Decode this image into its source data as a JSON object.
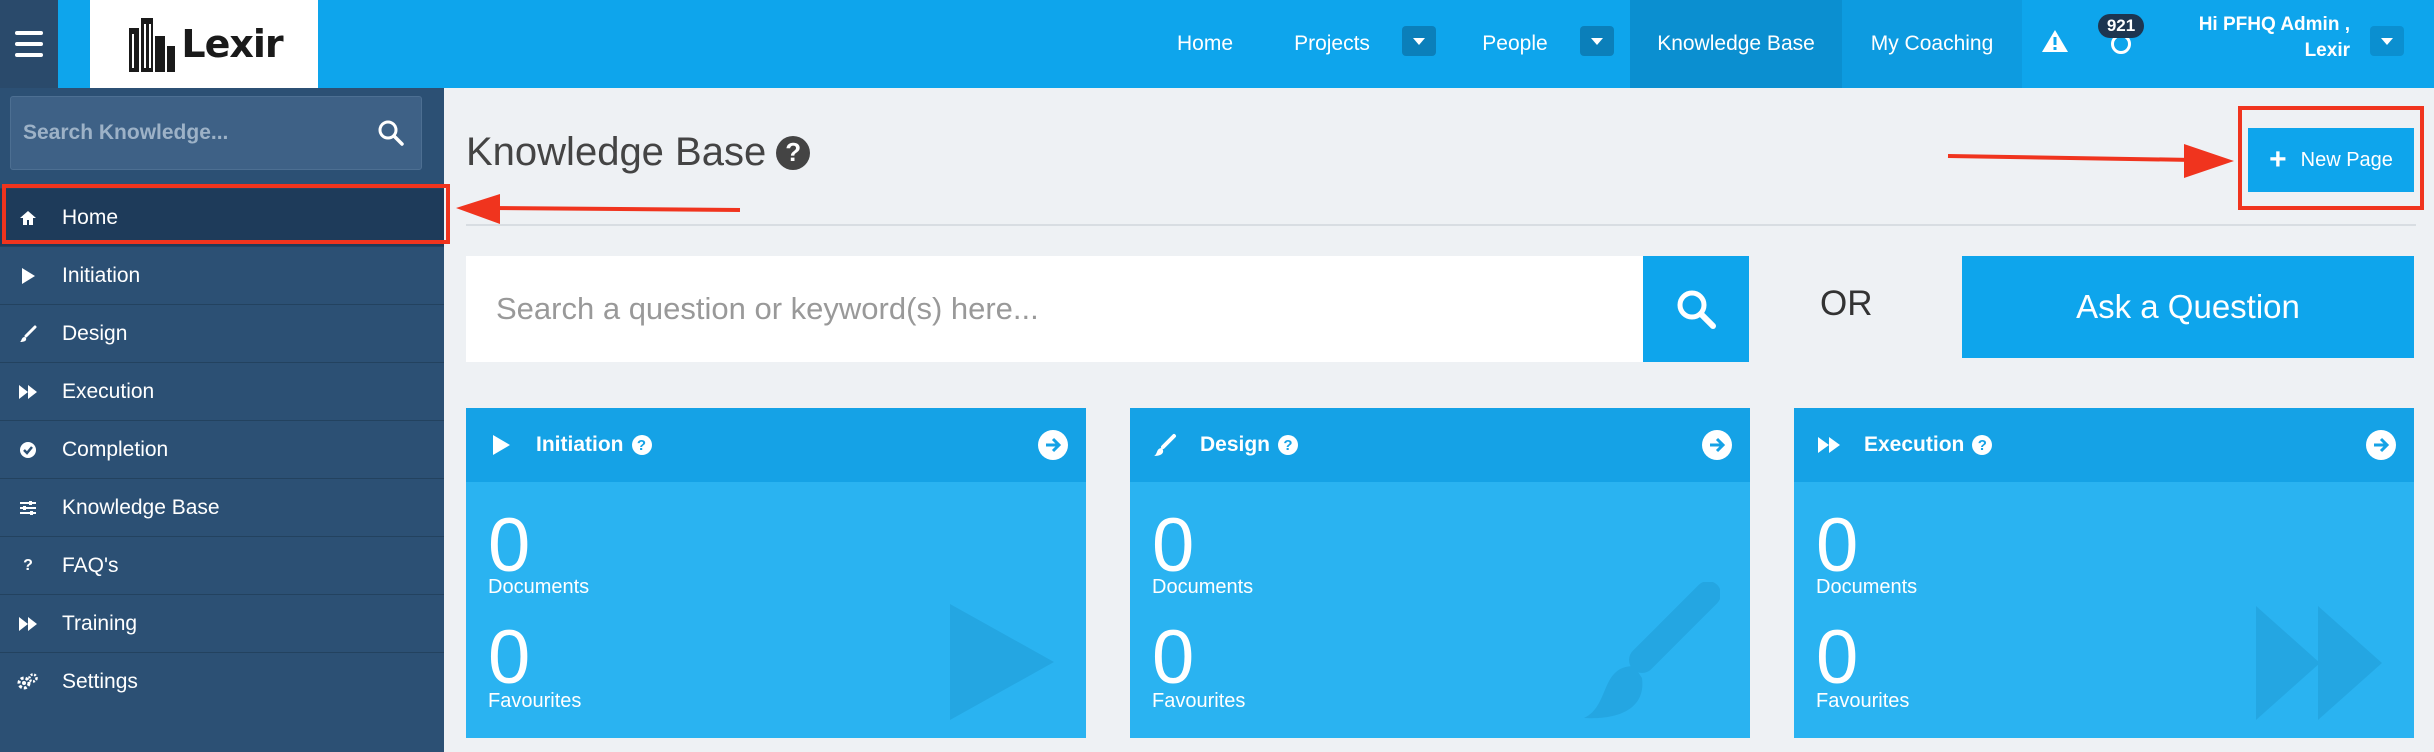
{
  "header": {
    "logo_text": "Lexir",
    "nav": [
      {
        "label": "Home"
      },
      {
        "label": "Projects"
      },
      {
        "label": "People"
      },
      {
        "label": "Knowledge Base"
      },
      {
        "label": "My Coaching"
      }
    ],
    "notification_count": "921",
    "user_greeting": "Hi PFHQ Admin ,",
    "user_org": "Lexir"
  },
  "sidebar": {
    "search_placeholder": "Search Knowledge...",
    "items": [
      {
        "label": "Home",
        "icon": "home-icon"
      },
      {
        "label": "Initiation",
        "icon": "play-icon"
      },
      {
        "label": "Design",
        "icon": "brush-icon"
      },
      {
        "label": "Execution",
        "icon": "fast-forward-icon"
      },
      {
        "label": "Completion",
        "icon": "check-circle-icon"
      },
      {
        "label": "Knowledge Base",
        "icon": "sliders-icon"
      },
      {
        "label": "FAQ's",
        "icon": "question-icon"
      },
      {
        "label": "Training",
        "icon": "fast-forward-icon"
      },
      {
        "label": "Settings",
        "icon": "gears-icon"
      }
    ]
  },
  "main": {
    "title": "Knowledge Base",
    "new_page_label": "New Page",
    "search_placeholder": "Search a question or keyword(s) here...",
    "or_label": "OR",
    "ask_label": "Ask a Question",
    "cards": [
      {
        "title": "Initiation",
        "documents": "0",
        "documents_label": "Documents",
        "favourites": "0",
        "favourites_label": "Favourites"
      },
      {
        "title": "Design",
        "documents": "0",
        "documents_label": "Documents",
        "favourites": "0",
        "favourites_label": "Favourites"
      },
      {
        "title": "Execution",
        "documents": "0",
        "documents_label": "Documents",
        "favourites": "0",
        "favourites_label": "Favourites"
      }
    ]
  },
  "colors": {
    "accent": "#0ea5ec",
    "sidebar": "#2c5074",
    "annotation": "#f0341e"
  }
}
